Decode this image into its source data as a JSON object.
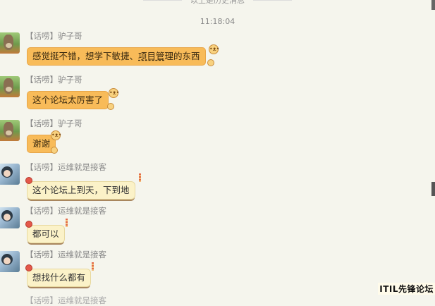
{
  "history_label": "以上是历史消息",
  "timestamp": "11:18:04",
  "messages": [
    {
      "sender": "【话唠】驴子哥",
      "text_pre": "感觉挺不错，想学下敏捷、",
      "text_underlined": "项目管",
      "text_post": "理的东西"
    },
    {
      "sender": "【话唠】驴子哥",
      "text": "这个论坛太厉害了"
    },
    {
      "sender": "【话唠】驴子哥",
      "text": "谢谢"
    },
    {
      "sender": "【话唠】运维就是接客",
      "text": "这个论坛上到天，下到地"
    },
    {
      "sender": "【话唠】运维就是接客",
      "text": "都可以"
    },
    {
      "sender": "【话唠】运维就是接客",
      "text": "想找什么都有"
    }
  ],
  "next_sender_partial": "【话唠】运维就是接客",
  "watermark": "ITIL先锋论坛"
}
